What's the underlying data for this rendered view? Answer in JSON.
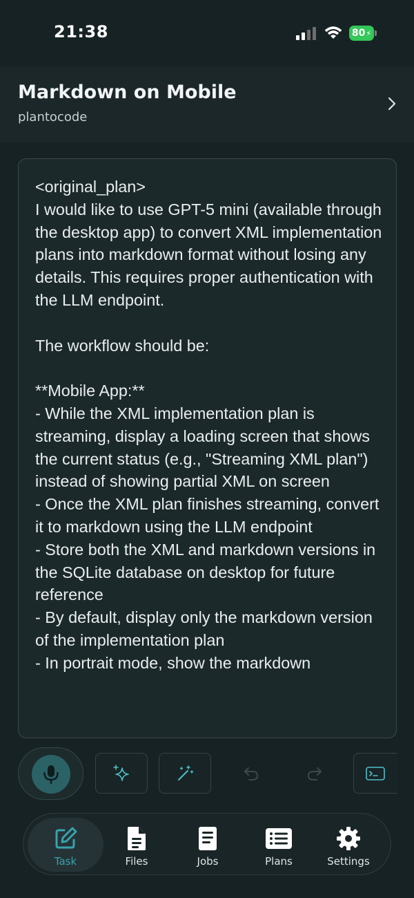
{
  "status_bar": {
    "time": "21:38",
    "battery": "80"
  },
  "header": {
    "title": "Markdown on Mobile",
    "subtitle": "plantocode"
  },
  "content": {
    "text": "<original_plan>\nI would like to use GPT-5 mini (available through the desktop app) to convert XML implementation plans into markdown format without losing any details. This requires proper authentication with the LLM endpoint.\n\nThe workflow should be:\n\n**Mobile App:**\n- While the XML implementation plan is streaming, display a loading screen that shows the current status (e.g., \"Streaming XML plan\") instead of showing partial XML on screen\n- Once the XML plan finishes streaming, convert it to markdown using the LLM endpoint\n- Store both the XML and markdown versions in the SQLite database on desktop for future reference\n- By default, display only the markdown version of the implementation plan\n- In portrait mode, show the markdown"
  },
  "toolbar": {
    "icons": [
      "microphone-icon",
      "sparkles-icon",
      "magic-wand-icon",
      "undo-icon",
      "redo-icon",
      "terminal-icon"
    ]
  },
  "tabbar": {
    "tabs": [
      {
        "label": "Task",
        "icon": "edit-icon",
        "active": true
      },
      {
        "label": "Files",
        "icon": "file-icon",
        "active": false
      },
      {
        "label": "Jobs",
        "icon": "document-icon",
        "active": false
      },
      {
        "label": "Plans",
        "icon": "list-icon",
        "active": false
      },
      {
        "label": "Settings",
        "icon": "gear-icon",
        "active": false
      }
    ]
  },
  "colors": {
    "background": "#172224",
    "accent": "#37a3ad",
    "mic_fill": "#2a6266",
    "battery": "#34c759"
  }
}
